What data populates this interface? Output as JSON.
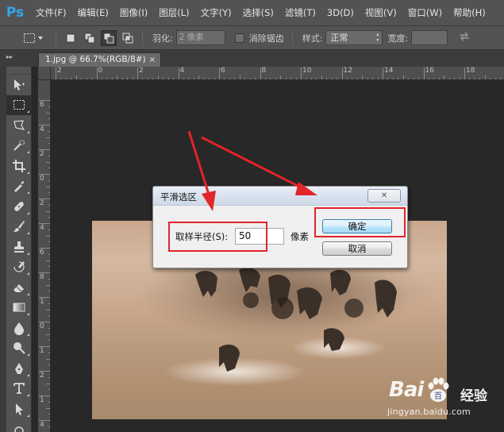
{
  "app": {
    "logo": "Ps",
    "menu": [
      "文件(F)",
      "编辑(E)",
      "图像(I)",
      "图层(L)",
      "文字(Y)",
      "选择(S)",
      "滤镜(T)",
      "3D(D)",
      "视图(V)",
      "窗口(W)",
      "帮助(H)"
    ]
  },
  "options": {
    "feather_label": "羽化:",
    "feather_value": "2 像素",
    "antialias_label": "消除锯齿",
    "style_label": "样式:",
    "style_value": "正常",
    "width_label": "宽度:"
  },
  "document_tab": {
    "title": "1.jpg @ 66.7%(RGB/8#)",
    "close_glyph": "×"
  },
  "ruler": {
    "top": [
      "2",
      "0",
      "2",
      "4",
      "6",
      "8",
      "10",
      "12",
      "14",
      "16",
      "18"
    ],
    "left": [
      "6",
      "4",
      "2",
      "0",
      "2",
      "4",
      "6",
      "8",
      "1",
      "0",
      "1",
      "2",
      "1",
      "4"
    ]
  },
  "dialog": {
    "title": "平滑选区",
    "close_glyph": "✕",
    "radius_label": "取样半径(S):",
    "radius_value": "50",
    "unit": "像素",
    "ok_label": "确定",
    "cancel_label": "取消"
  },
  "watermark": {
    "brand": "Bai",
    "brand_tail": "百",
    "product": "经验",
    "url": "jingyan.baidu.com"
  },
  "colors": {
    "accent_ps": "#34a6f0",
    "annotation_red": "#e2242b"
  }
}
